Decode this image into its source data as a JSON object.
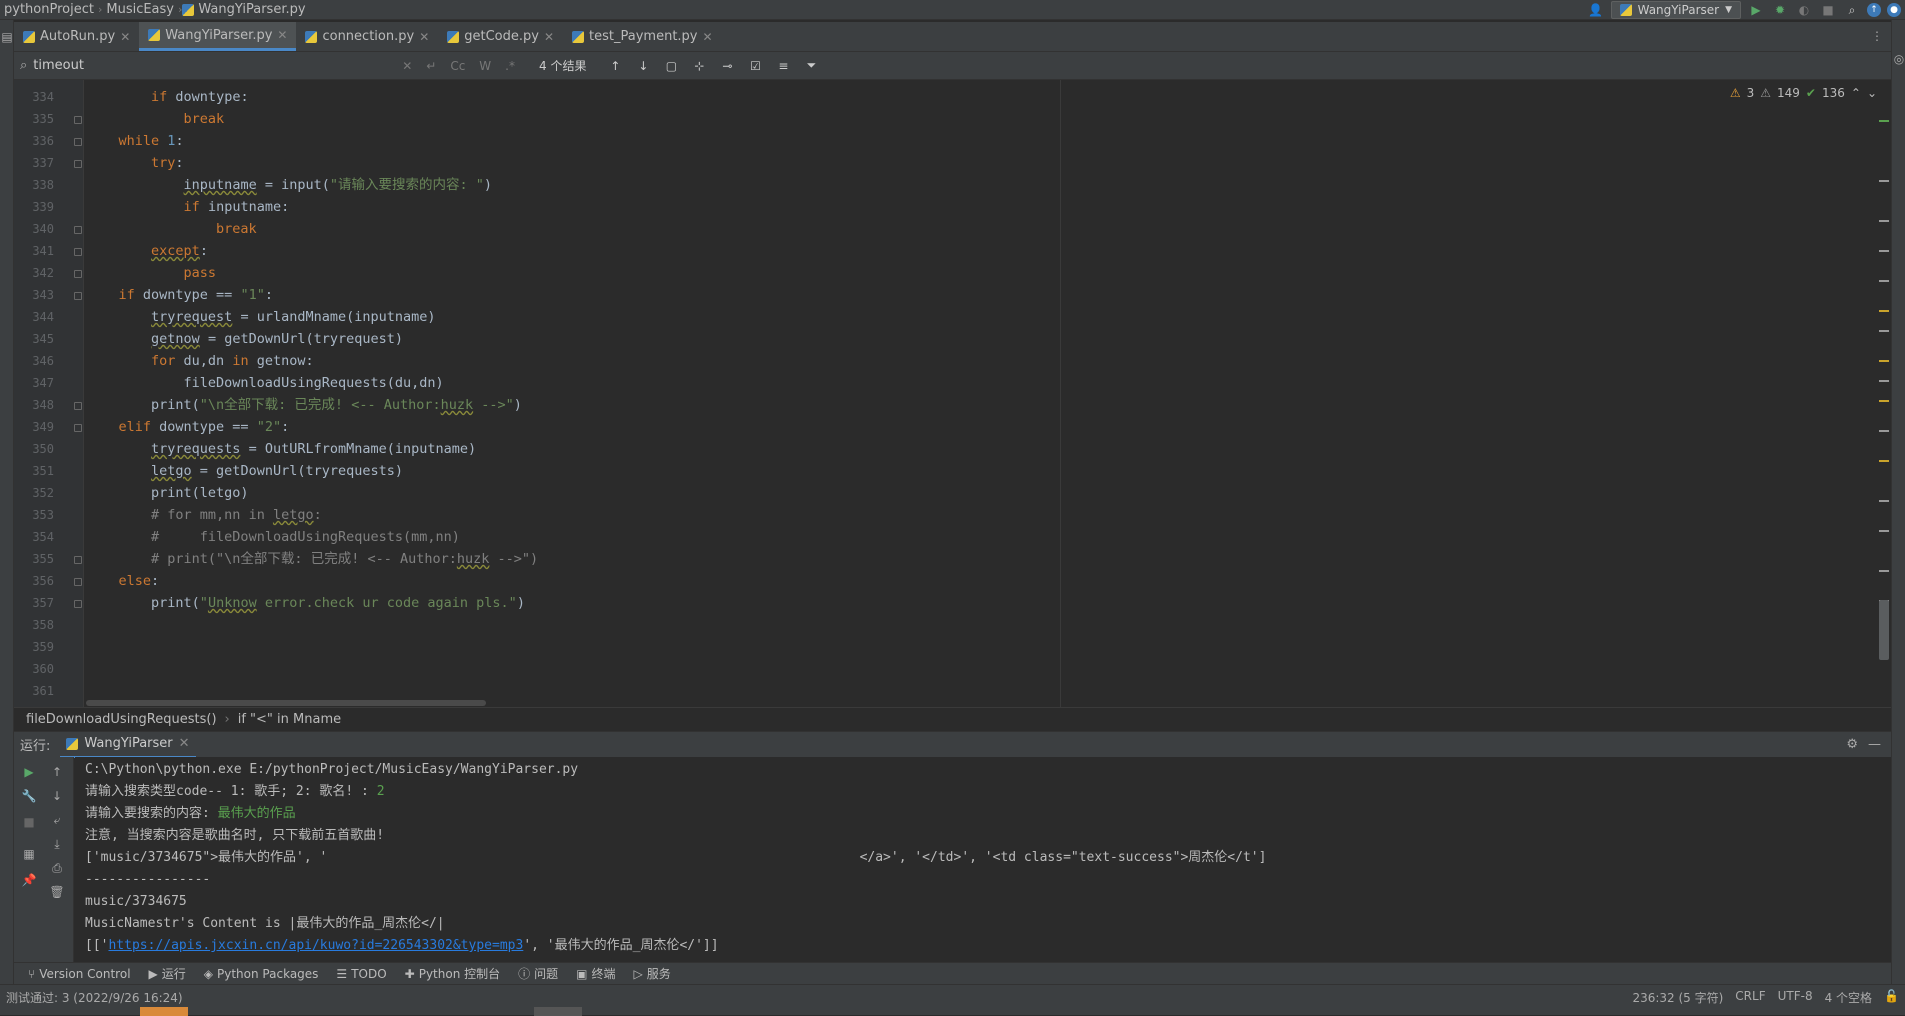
{
  "breadcrumb": [
    "pythonProject",
    "MusicEasy",
    "WangYiParser.py"
  ],
  "run_config": "WangYiParser",
  "tabs": [
    {
      "label": "AutoRun.py",
      "active": false
    },
    {
      "label": "WangYiParser.py",
      "active": true
    },
    {
      "label": "connection.py",
      "active": false
    },
    {
      "label": "getCode.py",
      "active": false
    },
    {
      "label": "test_Payment.py",
      "active": false
    }
  ],
  "search": {
    "query": "timeout",
    "result_count": "4 个结果",
    "match_case": "Cc",
    "words": "W",
    "regex": ".*"
  },
  "inspections": {
    "errors": "3",
    "warnings": "149",
    "ok": "136"
  },
  "code_lines": [
    {
      "n": "334",
      "html": "        <span class=\"kw\">if</span> downtype:"
    },
    {
      "n": "335",
      "html": "            <span class=\"kw\">break</span>"
    },
    {
      "n": "336",
      "html": "    <span class=\"kw\">while</span> <span class=\"num\">1</span>:"
    },
    {
      "n": "337",
      "html": "        <span class=\"kw\">try</span>:"
    },
    {
      "n": "338",
      "html": "            <span class=\"und\">inputname</span> = input(<span class=\"str\">\"请输入要搜索的内容: \"</span>)"
    },
    {
      "n": "339",
      "html": "            <span class=\"kw\">if</span> inputname:"
    },
    {
      "n": "340",
      "html": "                <span class=\"kw\">break</span>"
    },
    {
      "n": "341",
      "html": "        <span class=\"kw und\">except</span>:"
    },
    {
      "n": "342",
      "html": "            <span class=\"kw\">pass</span>"
    },
    {
      "n": "343",
      "html": "    <span class=\"kw\">if</span> downtype == <span class=\"str\">\"1\"</span>:"
    },
    {
      "n": "344",
      "html": "        <span class=\"und\">tryrequest</span> = urlandMname(inputname)"
    },
    {
      "n": "345",
      "html": "        <span class=\"und\">getnow</span> = getDownUrl(tryrequest)"
    },
    {
      "n": "346",
      "html": "        <span class=\"kw\">for</span> du,dn <span class=\"kw\">in</span> getnow:"
    },
    {
      "n": "347",
      "html": "            fileDownloadUsingRequests(du,dn)"
    },
    {
      "n": "348",
      "html": "        print(<span class=\"str\">\"\\n全部下载: 已完成! &lt;-- Author:<span class=\"und\">huzk</span> --&gt;\"</span>)"
    },
    {
      "n": "349",
      "html": "    <span class=\"kw\">elif</span> downtype == <span class=\"str\">\"2\"</span>:"
    },
    {
      "n": "350",
      "html": "        <span class=\"und\">tryrequests</span> = OutURLfromMname(inputname)"
    },
    {
      "n": "351",
      "html": "        <span class=\"und\">letgo</span> = getDownUrl(tryrequests)"
    },
    {
      "n": "352",
      "html": "        print(letgo)"
    },
    {
      "n": "353",
      "html": "        <span class=\"cm\"># for mm,nn in <span class=\"und\">letgo</span>:</span>"
    },
    {
      "n": "354",
      "html": "        <span class=\"cm\">#     fileDownloadUsingRequests(mm,nn)</span>"
    },
    {
      "n": "355",
      "html": "        <span class=\"cm\"># print(\"\\n全部下载: 已完成! &lt;-- Author:<span class=\"und\">huzk</span> --&gt;\")</span>"
    },
    {
      "n": "356",
      "html": "    <span class=\"kw\">else</span>:"
    },
    {
      "n": "357",
      "html": "        print(<span class=\"str\">\"<span class=\"und\">Unknow</span> error.check ur code again pls.\"</span>)"
    },
    {
      "n": "358",
      "html": ""
    },
    {
      "n": "359",
      "html": ""
    },
    {
      "n": "360",
      "html": ""
    },
    {
      "n": "361",
      "html": ""
    }
  ],
  "code_breadcrumb": [
    "fileDownloadUsingRequests()",
    "if \"<\" in Mname"
  ],
  "run_panel": {
    "label": "运行:",
    "tab": "WangYiParser"
  },
  "console_lines": [
    "C:\\Python\\python.exe E:/pythonProject/MusicEasy/WangYiParser.py",
    "请输入搜索类型code-- 1: 歌手; 2: 歌名! : ",
    "请输入要搜索的内容: ",
    "注意, 当搜索内容是歌曲名时, 只下载前五首歌曲!",
    "['music/3734675\">最伟大的作品', '                                                                    </a>', '</td>', '<td class=\"text-success\">周杰伦</t']",
    "----------------",
    "music/3734675",
    "MusicNamestr's Content is |最伟大的作品_周杰伦</|"
  ],
  "console_input": {
    "code": "2",
    "query": "最伟大的作品"
  },
  "console_last": {
    "prefix": "[['",
    "link": "https://apis.jxcxin.cn/api/kuwo?id=226543302&type=mp3",
    "suffix": "', '最伟大的作品_周杰伦</']]"
  },
  "bottom_tools": [
    "Version Control",
    "运行",
    "Python Packages",
    "TODO",
    "Python 控制台",
    "问题",
    "终端",
    "服务"
  ],
  "status": {
    "left": "测试通过: 3 (2022/9/26 16:24)",
    "position": "236:32 (5 字符)",
    "line_ending": "CRLF",
    "encoding": "UTF-8",
    "indent": "4 个空格"
  },
  "colors": {
    "keyword": "#cc7832",
    "string": "#6a8759",
    "number": "#6897bb",
    "comment": "#808080",
    "link": "#287bde",
    "accent": "#4a88c7"
  }
}
